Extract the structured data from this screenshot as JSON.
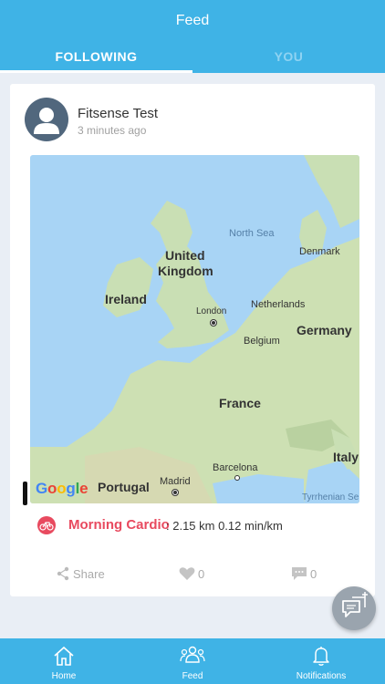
{
  "header": {
    "title": "Feed",
    "tabs": [
      {
        "label": "FOLLOWING",
        "active": true
      },
      {
        "label": "YOU",
        "active": false
      }
    ]
  },
  "post": {
    "user_name": "Fitsense Test",
    "time": "3 minutes ago",
    "map": {
      "labels": {
        "north_sea": "North Sea",
        "denmark": "Denmark",
        "united": "United",
        "kingdom": "Kingdom",
        "ireland": "Ireland",
        "netherlands": "Netherlands",
        "london": "London",
        "germany": "Germany",
        "belgium": "Belgium",
        "france": "France",
        "italy": "Italy",
        "portugal": "Portugal",
        "madrid": "Madrid",
        "barcelona": "Barcelona",
        "tyrrhenian": "Tyrrhenian Se"
      },
      "logo": [
        "G",
        "o",
        "o",
        "g",
        "l",
        "e"
      ]
    },
    "activity": {
      "name": "Morning Cardio",
      "stats": ": 2.15 km 0.12 min/km"
    },
    "actions": {
      "share_label": "Share",
      "like_count": "0",
      "comment_count": "0"
    }
  },
  "bottom_nav": [
    {
      "label": "Home",
      "icon": "home-icon"
    },
    {
      "label": "Feed",
      "icon": "people-icon"
    },
    {
      "label": "Notifications",
      "icon": "bell-icon"
    }
  ],
  "colors": {
    "primary": "#3fb3e6",
    "activity_accent": "#e84a5f",
    "background": "#e9eef5"
  }
}
